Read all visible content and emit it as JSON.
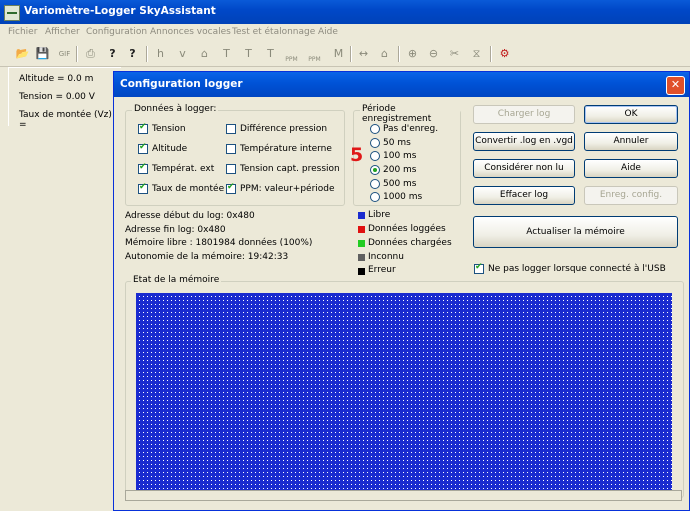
{
  "app": {
    "title": "Variomètre-Logger SkyAssistant"
  },
  "menu": {
    "items": [
      "Fichier",
      "Afficher",
      "Configuration",
      "Annonces vocales",
      "Test et étalonnage",
      "Aide"
    ]
  },
  "toolbar": {
    "buttons": [
      {
        "icon": "open-folder-icon",
        "glyph": "📂"
      },
      {
        "icon": "save-icon",
        "glyph": "💾"
      },
      {
        "icon": "gif-export-icon",
        "glyph": "GIF"
      },
      {
        "icon": "print-icon",
        "glyph": "⎙"
      },
      {
        "icon": "help-icon",
        "glyph": "?"
      },
      {
        "icon": "context-help-icon",
        "glyph": "?"
      },
      {
        "icon": "altitude-chart-icon",
        "glyph": "h"
      },
      {
        "icon": "vario-chart-icon",
        "glyph": "v"
      },
      {
        "icon": "chart-3-icon",
        "glyph": "⌂"
      },
      {
        "icon": "chart-4-icon",
        "glyph": "T"
      },
      {
        "icon": "chart-5-icon",
        "glyph": "T"
      },
      {
        "icon": "chart-6-icon",
        "glyph": "T"
      },
      {
        "icon": "ppm-icon",
        "glyph": "P"
      },
      {
        "icon": "ppm-2-icon",
        "glyph": "P"
      },
      {
        "icon": "chart-9-icon",
        "glyph": "M"
      },
      {
        "icon": "zoom-horizontal-icon",
        "glyph": "↔"
      },
      {
        "icon": "zoom-vertical-icon",
        "glyph": "⌂"
      },
      {
        "icon": "zoom-in-icon",
        "glyph": "⊕"
      },
      {
        "icon": "zoom-out-icon",
        "glyph": "⊖"
      },
      {
        "icon": "cut-icon",
        "glyph": "✂"
      },
      {
        "icon": "filter-icon",
        "glyph": "⧖"
      },
      {
        "icon": "logger-config-icon",
        "glyph": "⚙"
      }
    ],
    "ppm_label_1": "PPM",
    "ppm_label_2": "PPM"
  },
  "status": {
    "altitude": "Altitude = 0.0 m",
    "tension": "Tension = 0.00 V",
    "taux": "Taux de montée (Vz) ="
  },
  "dialog": {
    "title": "Configuration logger",
    "close_glyph": "✕",
    "donnees": {
      "legend": "Données à logger:",
      "items": [
        {
          "label": "Tension",
          "checked": true
        },
        {
          "label": "Altitude",
          "checked": true
        },
        {
          "label": "Températ. ext",
          "checked": true
        },
        {
          "label": "Taux de montée",
          "checked": true
        },
        {
          "label": "Différence pression",
          "checked": false
        },
        {
          "label": "Température interne",
          "checked": false
        },
        {
          "label": "Tension capt. pression",
          "checked": false
        },
        {
          "label": "PPM: valeur+période",
          "checked": true
        }
      ]
    },
    "periode": {
      "legend": "Période enregistrement",
      "options": [
        {
          "label": "Pas d'enreg.",
          "checked": false
        },
        {
          "label": "50 ms",
          "checked": false
        },
        {
          "label": "100 ms",
          "checked": false
        },
        {
          "label": "200 ms",
          "checked": true
        },
        {
          "label": "500 ms",
          "checked": false
        },
        {
          "label": "1000 ms",
          "checked": false
        }
      ],
      "annotation": "5"
    },
    "buttons": {
      "charger": "Charger log",
      "ok": "OK",
      "convertir": "Convertir .log en .vgd",
      "annuler": "Annuler",
      "considerer": "Considérer non lu",
      "aide": "Aide",
      "effacer": "Effacer log",
      "enreg": "Enreg. config.",
      "actualiser": "Actualiser la mémoire"
    },
    "info": {
      "debut": "Adresse début du log: 0x480",
      "fin": "Adresse fin log: 0x480",
      "libre": "Mémoire libre : 1801984 données (100%)",
      "autonomie": "Autonomie de la mémoire: 19:42:33"
    },
    "legend_items": [
      {
        "label": "Libre",
        "color": "#1a2bcf"
      },
      {
        "label": "Données loggées",
        "color": "#e01010"
      },
      {
        "label": "Données chargées",
        "color": "#22cc22"
      },
      {
        "label": "Inconnu",
        "color": "#606060"
      },
      {
        "label": "Erreur",
        "color": "#000000"
      }
    ],
    "usb_option": {
      "label": "Ne pas logger lorsque connecté à l'USB",
      "checked": true
    },
    "memory": {
      "legend": "Etat de la mémoire"
    }
  }
}
